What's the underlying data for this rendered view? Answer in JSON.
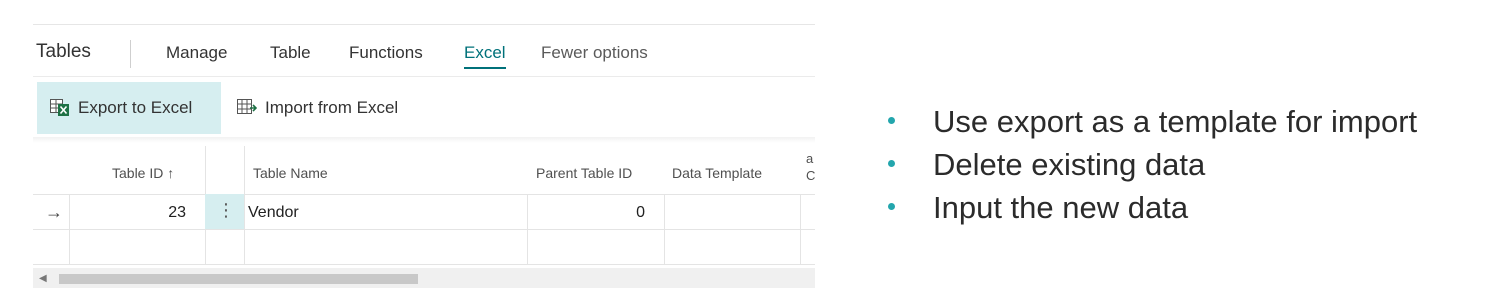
{
  "page_title": "Tables",
  "menu": {
    "manage": "Manage",
    "table": "Table",
    "functions": "Functions",
    "excel": "Excel",
    "fewer_options": "Fewer options"
  },
  "sub_actions": {
    "export": "Export to Excel",
    "import": "Import from Excel"
  },
  "grid": {
    "columns": {
      "table_id": "Table ID ↑",
      "table_name": "Table Name",
      "parent_table_id": "Parent Table ID",
      "data_template": "Data Template",
      "cut_off": "a\nC"
    },
    "rows": [
      {
        "indicator": "→",
        "table_id": "23",
        "table_name": "Vendor",
        "parent_table_id": "0",
        "data_template": ""
      }
    ]
  },
  "bullets": [
    "Use export as a template for import",
    "Delete existing data",
    "Input the new data"
  ],
  "colors": {
    "accent": "#00717a",
    "selection": "#d6eef0",
    "bullet": "#23a6ad"
  },
  "icons": {
    "export": "excel-export-icon",
    "import": "excel-import-icon"
  }
}
